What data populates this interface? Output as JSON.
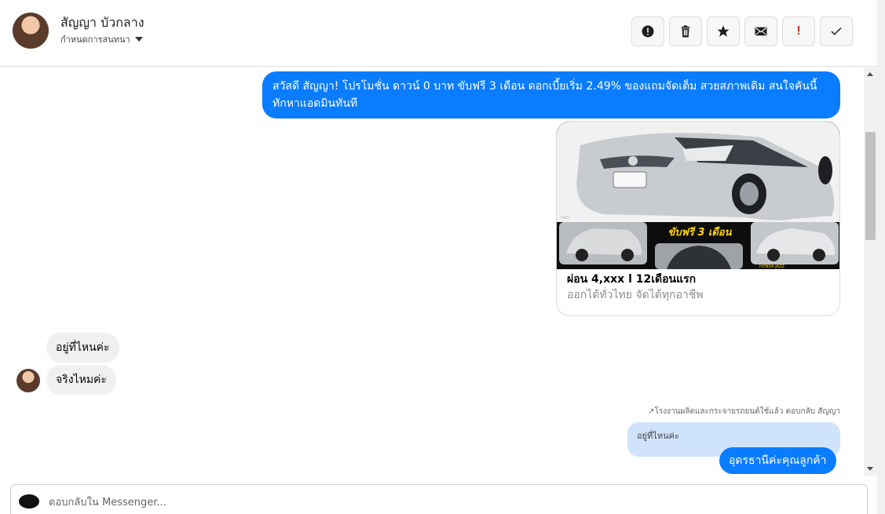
{
  "header": {
    "contact_name": "สัญญา บัวกลาง",
    "subtitle": "กำหนดการสนทนา",
    "actions": [
      {
        "icon": "alert-circle-icon"
      },
      {
        "icon": "trash-icon"
      },
      {
        "icon": "star-icon"
      },
      {
        "icon": "envelope-icon"
      },
      {
        "icon": "exclamation-icon",
        "label": "!"
      },
      {
        "icon": "check-icon"
      }
    ]
  },
  "messages": {
    "outgoing_promo": "สวัสดี สัญญา! โปรโมชั่น ดาวน์ 0 บาท ขับฟรี 3 เดือน ดอกเบี้ยเริ่ม 2.49% ของแถมจัดเต็ม สวยสภาพเดิม สนใจคันนี้ทักหาแอดมินทันที",
    "card": {
      "image_caption": "ขับฟรี 3 เดือน",
      "title": "ผ่อน 4,xxx l 12เดือนแรก",
      "subtitle": "ออกได้ทั่วไทย จัดได้ทุกอาชีพ"
    },
    "incoming_1": "อยู่ที่ไหนค่ะ",
    "incoming_2": "จริงไหมค่ะ",
    "reply_meta": "โรงงานผลิตและกระจายรถยนต์ใช้แล้ว ตอบกลับ สัญญา",
    "quoted_text": "อยู่ที่ไหนค่ะ",
    "outgoing_reply": "อุดรธานีค่ะคุณลูกค้า"
  },
  "composer": {
    "placeholder": "ตอบกลับใน Messenger..."
  },
  "colors": {
    "outgoing_bubble": "#0a7cff",
    "incoming_bubble": "#f0f0f0",
    "quoted_bubble": "#cfe3fb"
  }
}
